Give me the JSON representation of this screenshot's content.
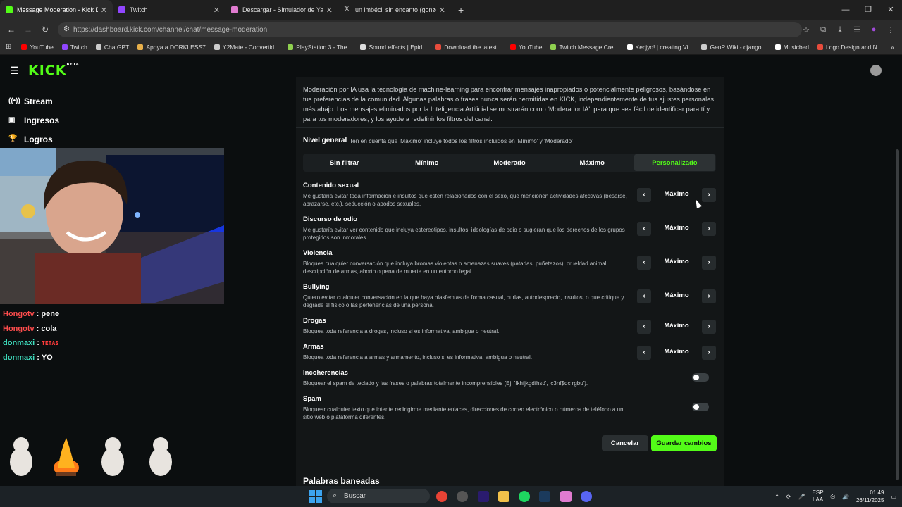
{
  "browser": {
    "tabs": [
      {
        "label": "Message Moderation - Kick Da",
        "color": "#53fc18",
        "active": true
      },
      {
        "label": "Twitch",
        "color": "#9146ff",
        "active": false
      },
      {
        "label": "Descargar - Simulador de Yand",
        "color": "#e07bd0",
        "active": false
      },
      {
        "label": "un imbécil sin encanto (gonzo",
        "color": "#ffffff",
        "active": false
      }
    ],
    "url": "https://dashboard.kick.com/channel/chat/message-moderation",
    "bookmarks": [
      {
        "label": "YouTube",
        "color": "#ff0000"
      },
      {
        "label": "Twitch",
        "color": "#9146ff"
      },
      {
        "label": "ChatGPT",
        "color": "#cccccc"
      },
      {
        "label": "Apoya a DORKLESS7",
        "color": "#e8b04a"
      },
      {
        "label": "Y2Mate - Convertid...",
        "color": "#cccccc"
      },
      {
        "label": "PlayStation 3 - The...",
        "color": "#8fd14f"
      },
      {
        "label": "Sound effects | Epid...",
        "color": "#dddddd"
      },
      {
        "label": "Download the latest...",
        "color": "#e74c3c"
      },
      {
        "label": "YouTube",
        "color": "#ff0000"
      },
      {
        "label": "Twitch Message Cre...",
        "color": "#8fd14f"
      },
      {
        "label": "Kecjyo! | creating Vi...",
        "color": "#ffffff"
      },
      {
        "label": "GenP Wiki - django...",
        "color": "#cccccc"
      },
      {
        "label": "Musicbed",
        "color": "#ffffff"
      },
      {
        "label": "Logo Design and N...",
        "color": "#e74c3c"
      }
    ]
  },
  "kick": {
    "logo": "KICK",
    "logo_tag": "BETA",
    "nav": [
      {
        "label": "Stream",
        "icon": "broadcast-icon"
      },
      {
        "label": "Ingresos",
        "icon": "money-icon"
      },
      {
        "label": "Logros",
        "icon": "trophy-icon"
      }
    ]
  },
  "chat": [
    {
      "user": "Hongotv",
      "user_color": "#ff4d4d",
      "message": "pene",
      "msg_color": "#ffffff"
    },
    {
      "user": "Hongotv",
      "user_color": "#ff4d4d",
      "message": "cola",
      "msg_color": "#ffffff"
    },
    {
      "user": "donmaxi",
      "user_color": "#3fe0c0",
      "message": "TETAS",
      "msg_color": "#ff3b3b"
    },
    {
      "user": "donmaxi",
      "user_color": "#3fe0c0",
      "message": "YO",
      "msg_color": "#ffffff"
    }
  ],
  "moderation": {
    "intro": "Moderación por IA usa la tecnología de machine-learning para encontrar mensajes inapropiados o potencialmente peligrosos, basándose en tus preferencias de la comunidad. Algunas palabras o frases nunca serán permitidas en KICK, independientemente de tus ajustes personales más abajo. Los mensajes eliminados por la Inteligencia Artificial se mostrarán como 'Moderador IA', para que sea fácil de identificar para tí y para tus moderadores, y los ayude a redefinir los filtros del canal.",
    "level_title": "Nivel general",
    "level_hint": "Ten en cuenta que 'Máximo' incluye todos los filtros incluidos en 'Mínimo' y 'Moderado'",
    "levels": [
      "Sin filtrar",
      "Mínimo",
      "Moderado",
      "Máximo",
      "Personalizado"
    ],
    "selected_level": "Personalizado",
    "categories": [
      {
        "name": "Contenido sexual",
        "desc": "Me gustaría evitar toda información e insultos que estén relacionados con el sexo, que mencionen actividades afectivas (besarse, abrazarse, etc.), seducción o apodos sexuales.",
        "value": "Máximo"
      },
      {
        "name": "Discurso de odio",
        "desc": "Me gustaría evitar ver contenido que incluya estereotipos, insultos, ideologías de odio o sugieran que los derechos de los grupos protegidos son inmorales.",
        "value": "Máximo"
      },
      {
        "name": "Violencia",
        "desc": "Bloquea cualquier conversación que incluya bromas violentas o amenazas suaves (patadas, puñetazos), crueldad animal, descripción de armas, aborto o pena de muerte en un entorno legal.",
        "value": "Máximo"
      },
      {
        "name": "Bullying",
        "desc": "Quiero evitar cualquier conversación en la que haya blasfemias de forma casual, burlas, autodesprecio, insultos, o que critique y degrade el físico o las pertenencias de una persona.",
        "value": "Máximo"
      },
      {
        "name": "Drogas",
        "desc": "Bloquea toda referencia a drogas, incluso si es informativa, ambigua o neutral.",
        "value": "Máximo"
      },
      {
        "name": "Armas",
        "desc": "Bloquea toda referencia a armas y armamento, incluso si es informativa, ambigua o neutral.",
        "value": "Máximo"
      }
    ],
    "toggles": [
      {
        "name": "Incoherencias",
        "desc": "Bloquear el spam de teclado y las frases o palabras totalmente incomprensibles (Ej: 'fkhfjkgdfhsd', 'c3nf$qc rgbu').",
        "enabled": false
      },
      {
        "name": "Spam",
        "desc": "Bloquear cualquier texto que intente redirigirme mediante enlaces, direcciones de correo electrónico o números de teléfono a un sitio web o plataforma diferentes.",
        "enabled": false
      }
    ],
    "cancel_label": "Cancelar",
    "save_label": "Guardar cambios",
    "next_section": "Palabras baneadas"
  },
  "taskbar": {
    "search_placeholder": "Buscar",
    "lang_top": "ESP",
    "lang_bottom": "LAA",
    "time": "01:49",
    "date": "26/11/2025"
  },
  "colors": {
    "accent": "#53fc18",
    "panel": "#131617",
    "background": "#0b0e0f"
  }
}
